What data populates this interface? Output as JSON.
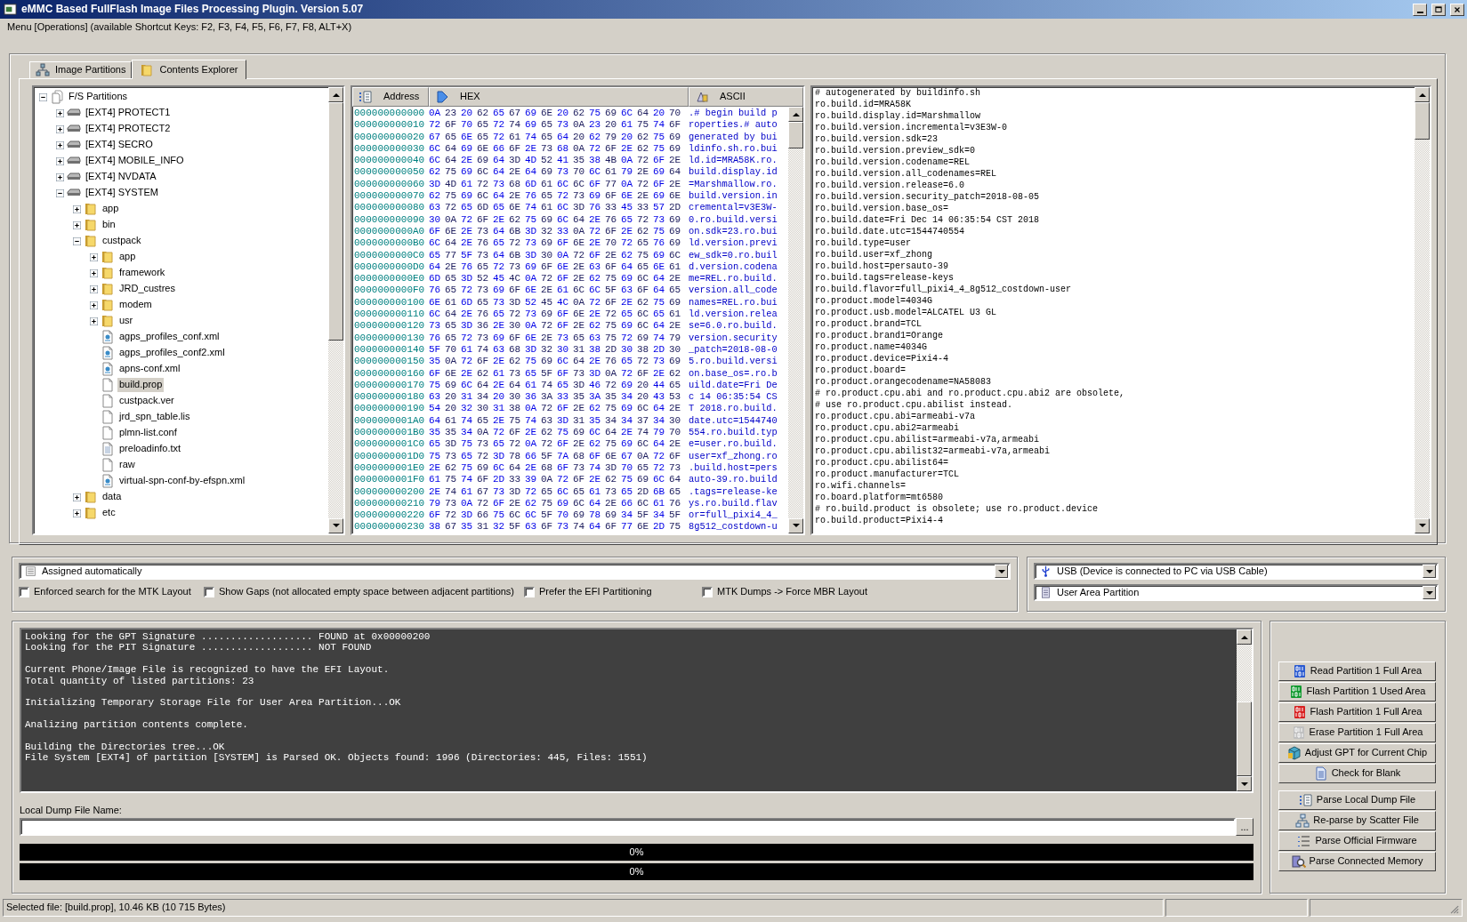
{
  "window": {
    "title": "eMMC Based FullFlash Image Files Processing Plugin. Version 5.07"
  },
  "menu_hint": "Menu [Operations] (available Shortcut Keys: F2, F3, F4, F5, F6, F7, F8, ALT+X)",
  "tabs": [
    {
      "label": "Image Partitions",
      "selected": false
    },
    {
      "label": "Contents Explorer",
      "selected": true
    }
  ],
  "tree": [
    {
      "label": "F/S Partitions",
      "kind": "root",
      "expanded": true,
      "selected": false,
      "children": [
        {
          "label": "[EXT4] PROTECT1",
          "kind": "partition",
          "expanded": false,
          "selected": false
        },
        {
          "label": "[EXT4] PROTECT2",
          "kind": "partition",
          "expanded": false,
          "selected": false
        },
        {
          "label": "[EXT4] SECRO",
          "kind": "partition",
          "expanded": false,
          "selected": false
        },
        {
          "label": "[EXT4] MOBILE_INFO",
          "kind": "partition",
          "expanded": false,
          "selected": false
        },
        {
          "label": "[EXT4] NVDATA",
          "kind": "partition",
          "expanded": false,
          "selected": false
        },
        {
          "label": "[EXT4] SYSTEM",
          "kind": "partition",
          "expanded": true,
          "selected": false,
          "children": [
            {
              "label": "app",
              "kind": "folder",
              "expanded": false,
              "selected": false
            },
            {
              "label": "bin",
              "kind": "folder",
              "expanded": false,
              "selected": false
            },
            {
              "label": "custpack",
              "kind": "folder",
              "expanded": true,
              "selected": false,
              "children": [
                {
                  "label": "app",
                  "kind": "folder",
                  "expanded": false,
                  "selected": false
                },
                {
                  "label": "framework",
                  "kind": "folder",
                  "expanded": false,
                  "selected": false
                },
                {
                  "label": "JRD_custres",
                  "kind": "folder",
                  "expanded": false,
                  "selected": false
                },
                {
                  "label": "modem",
                  "kind": "folder",
                  "expanded": false,
                  "selected": false
                },
                {
                  "label": "usr",
                  "kind": "folder",
                  "expanded": false,
                  "selected": false
                },
                {
                  "label": "agps_profiles_conf.xml",
                  "kind": "xml",
                  "selected": false
                },
                {
                  "label": "agps_profiles_conf2.xml",
                  "kind": "xml",
                  "selected": false
                },
                {
                  "label": "apns-conf.xml",
                  "kind": "xml",
                  "selected": false
                },
                {
                  "label": "build.prop",
                  "kind": "file",
                  "selected": true
                },
                {
                  "label": "custpack.ver",
                  "kind": "file",
                  "selected": false
                },
                {
                  "label": "jrd_spn_table.lis",
                  "kind": "file",
                  "selected": false
                },
                {
                  "label": "plmn-list.conf",
                  "kind": "file",
                  "selected": false
                },
                {
                  "label": "preloadinfo.txt",
                  "kind": "text",
                  "selected": false
                },
                {
                  "label": "raw",
                  "kind": "file",
                  "selected": false
                },
                {
                  "label": "virtual-spn-conf-by-efspn.xml",
                  "kind": "xml",
                  "selected": false
                }
              ]
            },
            {
              "label": "data",
              "kind": "folder",
              "expanded": false,
              "selected": false
            },
            {
              "label": "etc",
              "kind": "folder",
              "expanded": false,
              "selected": false
            }
          ]
        }
      ]
    }
  ],
  "hex_view": {
    "columns": [
      "Address",
      "HEX",
      "ASCII"
    ],
    "rows": [
      {
        "address": "000000000000",
        "hex": "0A 23 20 62 65 67 69 6E 20 62 75 69 6C 64 20 70",
        "ascii": ".# begin build p"
      },
      {
        "address": "000000000010",
        "hex": "72 6F 70 65 72 74 69 65 73 0A 23 20 61 75 74 6F",
        "ascii": "roperties.# auto"
      },
      {
        "address": "000000000020",
        "hex": "67 65 6E 65 72 61 74 65 64 20 62 79 20 62 75 69",
        "ascii": "generated by bui"
      },
      {
        "address": "000000000030",
        "hex": "6C 64 69 6E 66 6F 2E 73 68 0A 72 6F 2E 62 75 69",
        "ascii": "ldinfo.sh.ro.bui"
      },
      {
        "address": "000000000040",
        "hex": "6C 64 2E 69 64 3D 4D 52 41 35 38 4B 0A 72 6F 2E",
        "ascii": "ld.id=MRA58K.ro."
      },
      {
        "address": "000000000050",
        "hex": "62 75 69 6C 64 2E 64 69 73 70 6C 61 79 2E 69 64",
        "ascii": "build.display.id"
      },
      {
        "address": "000000000060",
        "hex": "3D 4D 61 72 73 68 6D 61 6C 6C 6F 77 0A 72 6F 2E",
        "ascii": "=Marshmallow.ro."
      },
      {
        "address": "000000000070",
        "hex": "62 75 69 6C 64 2E 76 65 72 73 69 6F 6E 2E 69 6E",
        "ascii": "build.version.in"
      },
      {
        "address": "000000000080",
        "hex": "63 72 65 6D 65 6E 74 61 6C 3D 76 33 45 33 57 2D",
        "ascii": "cremental=v3E3W-"
      },
      {
        "address": "000000000090",
        "hex": "30 0A 72 6F 2E 62 75 69 6C 64 2E 76 65 72 73 69",
        "ascii": "0.ro.build.versi"
      },
      {
        "address": "0000000000A0",
        "hex": "6F 6E 2E 73 64 6B 3D 32 33 0A 72 6F 2E 62 75 69",
        "ascii": "on.sdk=23.ro.bui"
      },
      {
        "address": "0000000000B0",
        "hex": "6C 64 2E 76 65 72 73 69 6F 6E 2E 70 72 65 76 69",
        "ascii": "ld.version.previ"
      },
      {
        "address": "0000000000C0",
        "hex": "65 77 5F 73 64 6B 3D 30 0A 72 6F 2E 62 75 69 6C",
        "ascii": "ew_sdk=0.ro.buil"
      },
      {
        "address": "0000000000D0",
        "hex": "64 2E 76 65 72 73 69 6F 6E 2E 63 6F 64 65 6E 61",
        "ascii": "d.version.codena"
      },
      {
        "address": "0000000000E0",
        "hex": "6D 65 3D 52 45 4C 0A 72 6F 2E 62 75 69 6C 64 2E",
        "ascii": "me=REL.ro.build."
      },
      {
        "address": "0000000000F0",
        "hex": "76 65 72 73 69 6F 6E 2E 61 6C 6C 5F 63 6F 64 65",
        "ascii": "version.all_code"
      },
      {
        "address": "000000000100",
        "hex": "6E 61 6D 65 73 3D 52 45 4C 0A 72 6F 2E 62 75 69",
        "ascii": "names=REL.ro.bui"
      },
      {
        "address": "000000000110",
        "hex": "6C 64 2E 76 65 72 73 69 6F 6E 2E 72 65 6C 65 61",
        "ascii": "ld.version.relea"
      },
      {
        "address": "000000000120",
        "hex": "73 65 3D 36 2E 30 0A 72 6F 2E 62 75 69 6C 64 2E",
        "ascii": "se=6.0.ro.build."
      },
      {
        "address": "000000000130",
        "hex": "76 65 72 73 69 6F 6E 2E 73 65 63 75 72 69 74 79",
        "ascii": "version.security"
      },
      {
        "address": "000000000140",
        "hex": "5F 70 61 74 63 68 3D 32 30 31 38 2D 30 38 2D 30",
        "ascii": "_patch=2018-08-0"
      },
      {
        "address": "000000000150",
        "hex": "35 0A 72 6F 2E 62 75 69 6C 64 2E 76 65 72 73 69",
        "ascii": "5.ro.build.versi"
      },
      {
        "address": "000000000160",
        "hex": "6F 6E 2E 62 61 73 65 5F 6F 73 3D 0A 72 6F 2E 62",
        "ascii": "on.base_os=.ro.b"
      },
      {
        "address": "000000000170",
        "hex": "75 69 6C 64 2E 64 61 74 65 3D 46 72 69 20 44 65",
        "ascii": "uild.date=Fri De"
      },
      {
        "address": "000000000180",
        "hex": "63 20 31 34 20 30 36 3A 33 35 3A 35 34 20 43 53",
        "ascii": "c 14 06:35:54 CS"
      },
      {
        "address": "000000000190",
        "hex": "54 20 32 30 31 38 0A 72 6F 2E 62 75 69 6C 64 2E",
        "ascii": "T 2018.ro.build."
      },
      {
        "address": "0000000001A0",
        "hex": "64 61 74 65 2E 75 74 63 3D 31 35 34 34 37 34 30",
        "ascii": "date.utc=1544740"
      },
      {
        "address": "0000000001B0",
        "hex": "35 35 34 0A 72 6F 2E 62 75 69 6C 64 2E 74 79 70",
        "ascii": "554.ro.build.typ"
      },
      {
        "address": "0000000001C0",
        "hex": "65 3D 75 73 65 72 0A 72 6F 2E 62 75 69 6C 64 2E",
        "ascii": "e=user.ro.build."
      },
      {
        "address": "0000000001D0",
        "hex": "75 73 65 72 3D 78 66 5F 7A 68 6F 6E 67 0A 72 6F",
        "ascii": "user=xf_zhong.ro"
      },
      {
        "address": "0000000001E0",
        "hex": "2E 62 75 69 6C 64 2E 68 6F 73 74 3D 70 65 72 73",
        "ascii": ".build.host=pers"
      },
      {
        "address": "0000000001F0",
        "hex": "61 75 74 6F 2D 33 39 0A 72 6F 2E 62 75 69 6C 64",
        "ascii": "auto-39.ro.build"
      },
      {
        "address": "000000000200",
        "hex": "2E 74 61 67 73 3D 72 65 6C 65 61 73 65 2D 6B 65",
        "ascii": ".tags=release-ke"
      },
      {
        "address": "000000000210",
        "hex": "79 73 0A 72 6F 2E 62 75 69 6C 64 2E 66 6C 61 76",
        "ascii": "ys.ro.build.flav"
      },
      {
        "address": "000000000220",
        "hex": "6F 72 3D 66 75 6C 6C 5F 70 69 78 69 34 5F 34 5F",
        "ascii": "or=full_pixi4_4_"
      },
      {
        "address": "000000000230",
        "hex": "38 67 35 31 32 5F 63 6F 73 74 64 6F 77 6E 2D 75",
        "ascii": "8g512_costdown-u"
      }
    ]
  },
  "text_view": {
    "lines": [
      "# autogenerated by buildinfo.sh",
      "ro.build.id=MRA58K",
      "ro.build.display.id=Marshmallow",
      "ro.build.version.incremental=v3E3W-0",
      "ro.build.version.sdk=23",
      "ro.build.version.preview_sdk=0",
      "ro.build.version.codename=REL",
      "ro.build.version.all_codenames=REL",
      "ro.build.version.release=6.0",
      "ro.build.version.security_patch=2018-08-05",
      "ro.build.version.base_os=",
      "ro.build.date=Fri Dec 14 06:35:54 CST 2018",
      "ro.build.date.utc=1544740554",
      "ro.build.type=user",
      "ro.build.user=xf_zhong",
      "ro.build.host=persauto-39",
      "ro.build.tags=release-keys",
      "ro.build.flavor=full_pixi4_4_8g512_costdown-user",
      "ro.product.model=4034G",
      "ro.product.usb.model=ALCATEL U3 GL",
      "ro.product.brand=TCL",
      "ro.product.brand1=Orange",
      "ro.product.name=4034G",
      "ro.product.device=Pixi4-4",
      "ro.product.board=",
      "ro.product.orangecodename=NA58083",
      "# ro.product.cpu.abi and ro.product.cpu.abi2 are obsolete,",
      "# use ro.product.cpu.abilist instead.",
      "ro.product.cpu.abi=armeabi-v7a",
      "ro.product.cpu.abi2=armeabi",
      "ro.product.cpu.abilist=armeabi-v7a,armeabi",
      "ro.product.cpu.abilist32=armeabi-v7a,armeabi",
      "ro.product.cpu.abilist64=",
      "ro.product.manufacturer=TCL",
      "ro.wifi.channels=",
      "ro.board.platform=mt6580",
      "# ro.build.product is obsolete; use ro.product.device",
      "ro.build.product=Pixi4-4"
    ]
  },
  "layout_combo": {
    "value": "Assigned automatically"
  },
  "options": [
    {
      "label": "Enforced search for the MTK Layout",
      "checked": false
    },
    {
      "label": "Show Gaps (not allocated empty space between adjacent partitions)",
      "checked": false
    },
    {
      "label": "Prefer the EFI Partitioning",
      "checked": false
    },
    {
      "label": "MTK Dumps -> Force MBR Layout",
      "checked": false
    }
  ],
  "connection_combo": {
    "value": "USB (Device is connected to PC via USB Cable)"
  },
  "area_combo": {
    "value": "User Area Partition"
  },
  "log": [
    [
      "Looking for the GPT Signature ................... FOUND at 0x00000200",
      "Looking for the PIT Signature ................... NOT FOUND"
    ],
    [
      "Current Phone/Image File is recognized to have the EFI Layout.",
      "Total quantity of listed partitions: 23"
    ],
    [
      "Initializing Temporary Storage File for User Area Partition...OK"
    ],
    [
      "Analizing partition contents complete."
    ],
    [
      "Building the Directories tree...OK",
      "File System [EXT4] of partition [SYSTEM] is Parsed OK. Objects found: 1996 (Directories: 445, Files: 1551)"
    ]
  ],
  "dump_file": {
    "label": "Local Dump File Name:",
    "browse": "..."
  },
  "progress": [
    {
      "level": 0,
      "text": "0%"
    },
    {
      "level": 0,
      "text": "0%"
    }
  ],
  "button_groups": [
    [
      "Read Partition 1 Full Area",
      "Flash Partition 1 Used Area",
      "Flash Partition 1 Full Area",
      "Erase Partition 1 Full Area",
      "Adjust GPT for Current Chip",
      "Check for Blank"
    ],
    [
      "Parse Local Dump File",
      "Re-parse by Scatter File",
      "Parse Official Firmware",
      "Parse Connected Memory"
    ]
  ],
  "status_bar": {
    "text": "Selected file: [build.prop], 10.46 KB (10 715 Bytes)"
  }
}
